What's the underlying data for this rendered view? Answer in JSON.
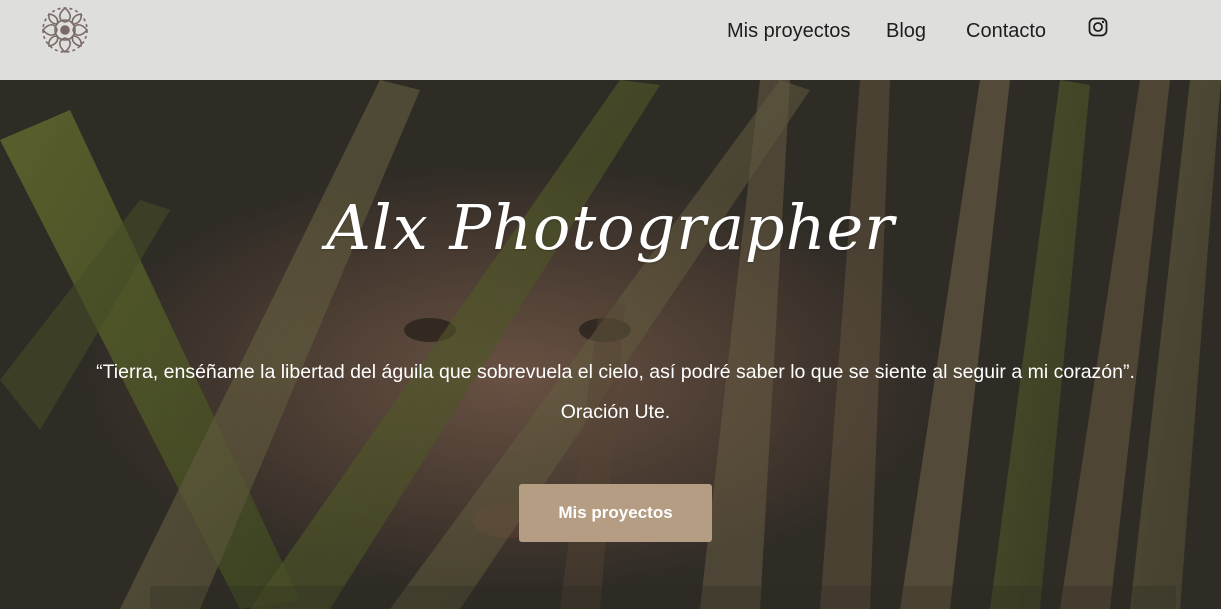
{
  "header": {
    "logo_icon": "floral-ornament-logo",
    "nav": [
      {
        "label": "Mis proyectos"
      },
      {
        "label": "Blog"
      },
      {
        "label": "Contacto"
      }
    ],
    "social_icon": "instagram-icon"
  },
  "hero": {
    "background_icon": "leaves-portrait-photo",
    "title": "Alx Photographer",
    "quote_line_1": "“Tierra, enséñame la libertad del águila que sobrevuela el cielo, así podré saber lo que se siente al seguir a mi corazón”.",
    "quote_line_2": "Oración Ute.",
    "cta_label": "Mis proyectos",
    "cta_color": "#b49d82"
  },
  "colors": {
    "header_bg": "#ececec",
    "nav_text": "#1e1e1e",
    "hero_text": "#ffffff"
  }
}
